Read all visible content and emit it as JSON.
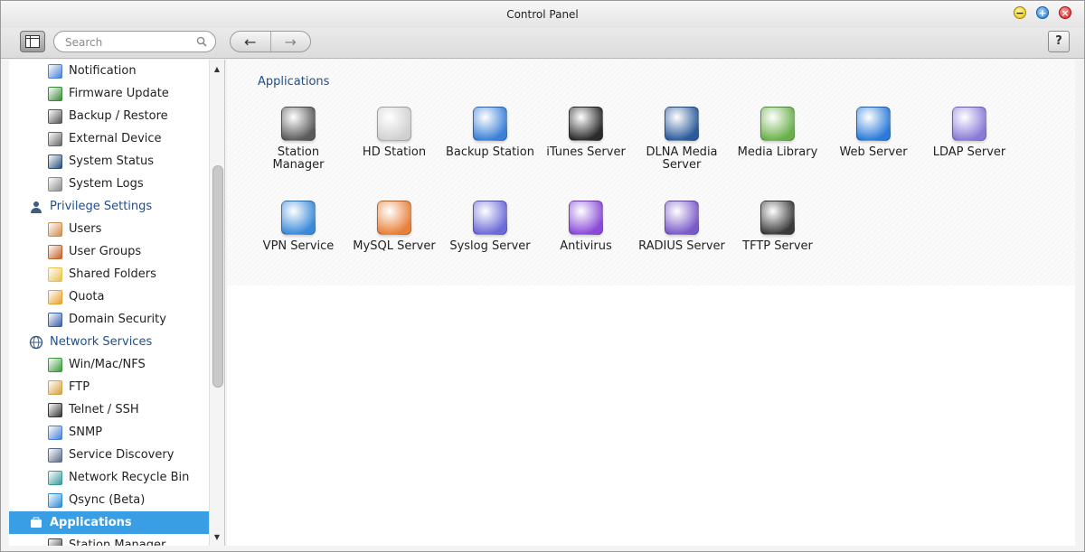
{
  "window": {
    "title": "Control Panel"
  },
  "toolbar": {
    "search_placeholder": "Search",
    "help_label": "?"
  },
  "sidebar": {
    "items": [
      {
        "type": "item",
        "label": "Notification",
        "icon": "notification-icon",
        "color": "#4a7fd8"
      },
      {
        "type": "item",
        "label": "Firmware Update",
        "icon": "firmware-update-icon",
        "color": "#3a8a3a"
      },
      {
        "type": "item",
        "label": "Backup / Restore",
        "icon": "backup-restore-icon",
        "color": "#555555"
      },
      {
        "type": "item",
        "label": "External Device",
        "icon": "external-device-icon",
        "color": "#666666"
      },
      {
        "type": "item",
        "label": "System Status",
        "icon": "system-status-icon",
        "color": "#2a4d7a"
      },
      {
        "type": "item",
        "label": "System Logs",
        "icon": "system-logs-icon",
        "color": "#8a8a8a"
      },
      {
        "type": "category",
        "label": "Privilege Settings",
        "icon": "user-icon"
      },
      {
        "type": "item",
        "label": "Users",
        "icon": "users-icon",
        "color": "#d08b4a"
      },
      {
        "type": "item",
        "label": "User Groups",
        "icon": "user-groups-icon",
        "color": "#c4602a"
      },
      {
        "type": "item",
        "label": "Shared Folders",
        "icon": "shared-folders-icon",
        "color": "#e8c04a"
      },
      {
        "type": "item",
        "label": "Quota",
        "icon": "quota-icon",
        "color": "#e8a030"
      },
      {
        "type": "item",
        "label": "Domain Security",
        "icon": "domain-security-icon",
        "color": "#3a5fa8"
      },
      {
        "type": "category",
        "label": "Network Services",
        "icon": "globe-icon"
      },
      {
        "type": "item",
        "label": "Win/Mac/NFS",
        "icon": "win-mac-nfs-icon",
        "color": "#3a9a3a"
      },
      {
        "type": "item",
        "label": "FTP",
        "icon": "ftp-icon",
        "color": "#d8a040"
      },
      {
        "type": "item",
        "label": "Telnet / SSH",
        "icon": "telnet-ssh-icon",
        "color": "#333333"
      },
      {
        "type": "item",
        "label": "SNMP",
        "icon": "snmp-icon",
        "color": "#4a7fd8"
      },
      {
        "type": "item",
        "label": "Service Discovery",
        "icon": "service-discovery-icon",
        "color": "#5a6a8a"
      },
      {
        "type": "item",
        "label": "Network Recycle Bin",
        "icon": "network-recycle-bin-icon",
        "color": "#3a9a9a"
      },
      {
        "type": "item",
        "label": "Qsync (Beta)",
        "icon": "qsync-icon",
        "color": "#2a8ad8"
      },
      {
        "type": "category",
        "label": "Applications",
        "icon": "applications-icon",
        "active": true
      },
      {
        "type": "item",
        "label": "Station Manager",
        "icon": "station-manager-icon",
        "color": "#444444"
      }
    ]
  },
  "main": {
    "section_title": "Applications",
    "apps": [
      {
        "label": "Station Manager",
        "icon": "station-manager-icon",
        "color": "#5a5a5a"
      },
      {
        "label": "HD Station",
        "icon": "hd-station-icon",
        "color": "#d0d0d0"
      },
      {
        "label": "Backup Station",
        "icon": "backup-station-icon",
        "color": "#3a7fd8"
      },
      {
        "label": "iTunes Server",
        "icon": "itunes-server-icon",
        "color": "#2a2a2a"
      },
      {
        "label": "DLNA Media Server",
        "icon": "dlna-media-server-icon",
        "color": "#2a5a9a"
      },
      {
        "label": "Media Library",
        "icon": "media-library-icon",
        "color": "#6ab04a"
      },
      {
        "label": "Web Server",
        "icon": "web-server-icon",
        "color": "#2a7ad8"
      },
      {
        "label": "LDAP Server",
        "icon": "ldap-server-icon",
        "color": "#8a7ad8"
      },
      {
        "label": "VPN Service",
        "icon": "vpn-service-icon",
        "color": "#3a8ad8"
      },
      {
        "label": "MySQL Server",
        "icon": "mysql-server-icon",
        "color": "#e8803a"
      },
      {
        "label": "Syslog Server",
        "icon": "syslog-server-icon",
        "color": "#6a6ad8"
      },
      {
        "label": "Antivirus",
        "icon": "antivirus-icon",
        "color": "#8a4ad8"
      },
      {
        "label": "RADIUS Server",
        "icon": "radius-server-icon",
        "color": "#7a5ac8"
      },
      {
        "label": "TFTP Server",
        "icon": "tftp-server-icon",
        "color": "#3a3a3a"
      }
    ]
  }
}
